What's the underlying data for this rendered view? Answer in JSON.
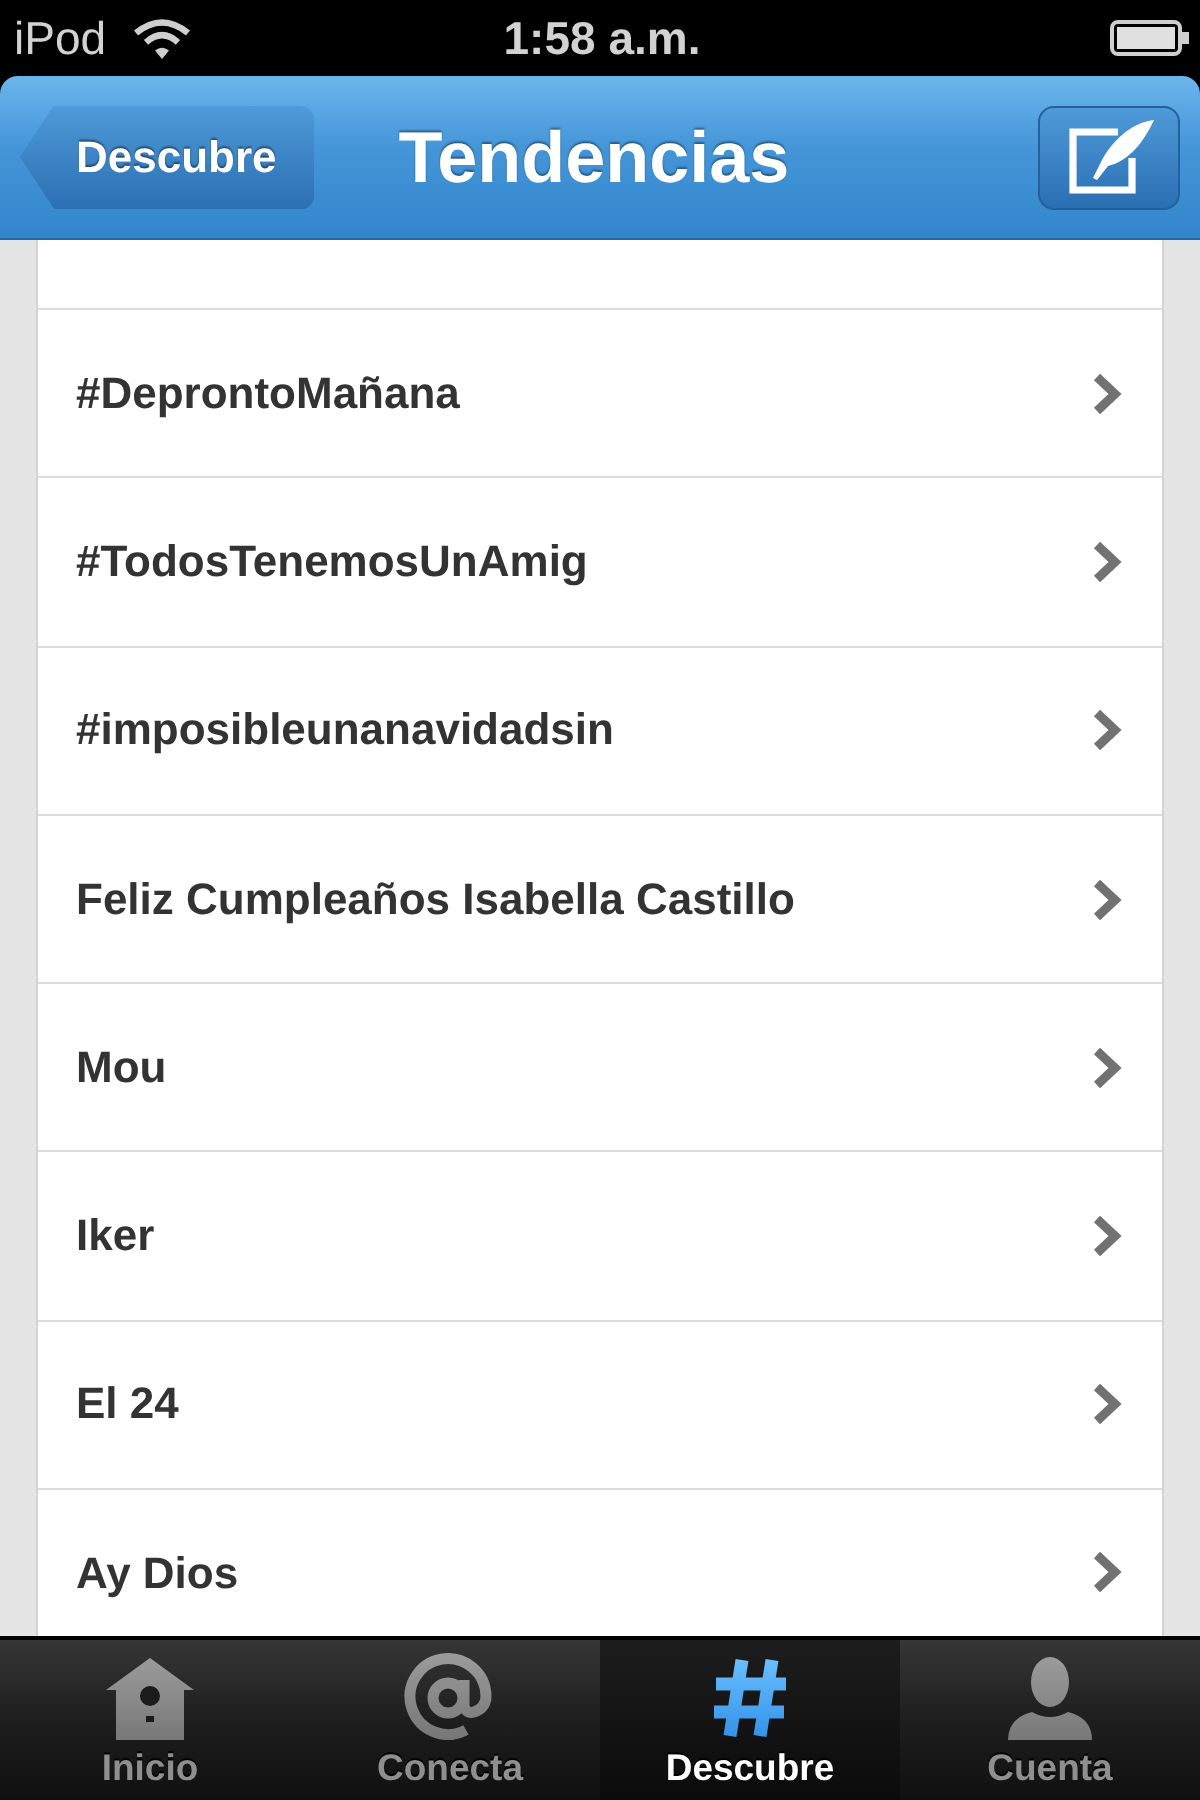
{
  "status_bar": {
    "device": "iPod",
    "time": "1:58 a.m."
  },
  "nav_bar": {
    "back_button": "Descubre",
    "title": "Tendencias"
  },
  "trends": [
    {
      "label": "#DeprontoMañana"
    },
    {
      "label": "#TodosTenemosUnAmig"
    },
    {
      "label": "#imposibleunanavidadsin"
    },
    {
      "label": "Feliz Cumpleaños Isabella Castillo"
    },
    {
      "label": "Mou"
    },
    {
      "label": "Iker"
    },
    {
      "label": "El 24"
    },
    {
      "label": "Ay Dios"
    }
  ],
  "tab_bar": {
    "tabs": [
      {
        "label": "Inicio",
        "selected": false
      },
      {
        "label": "Conecta",
        "selected": false
      },
      {
        "label": "Descubre",
        "selected": true
      },
      {
        "label": "Cuenta",
        "selected": false
      }
    ]
  }
}
